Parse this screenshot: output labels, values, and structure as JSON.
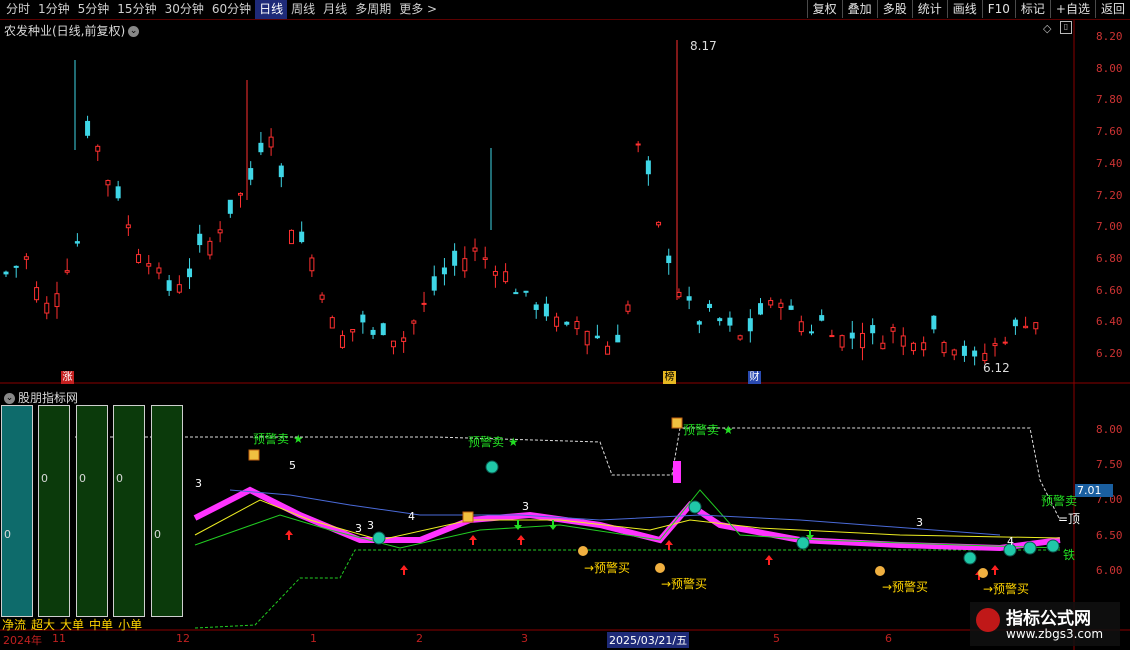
{
  "toolbar": {
    "periods": [
      "分时",
      "1分钟",
      "5分钟",
      "15分钟",
      "30分钟",
      "60分钟",
      "日线",
      "周线",
      "月线",
      "多周期",
      "更多 >"
    ],
    "active_period": "日线",
    "buttons": [
      "复权",
      "叠加",
      "多股",
      "统计",
      "画线",
      "F10",
      "标记",
      "+自选",
      "返回"
    ]
  },
  "stock": {
    "title": "农发种业(日线,前复权)",
    "high_label": "8.17",
    "low_label": "6.12",
    "marks": [
      "涨",
      "榜",
      "财"
    ],
    "price_axis": [
      "8.20",
      "8.00",
      "7.80",
      "7.60",
      "7.40",
      "7.20",
      "7.00",
      "6.80",
      "6.60",
      "6.40",
      "6.20"
    ]
  },
  "indicator": {
    "title": "股朋指标网",
    "axis": [
      "8.00",
      "7.50",
      "7.00",
      "6.50",
      "6.00"
    ],
    "current_value": "7.01",
    "signal_sell": "预警卖",
    "signal_buy": "→预警买",
    "side_text_1": "=顶",
    "side_text_2": "铁",
    "counts": [
      "3",
      "5",
      "3",
      "3",
      "4",
      "3",
      "3",
      "4"
    ]
  },
  "flow": {
    "labels": [
      "净流",
      "超大",
      "大单",
      "中单",
      "小单"
    ],
    "values": [
      "0",
      "0",
      "0",
      "0",
      "0"
    ],
    "colors": [
      "#0e6b6b",
      "#0b3a0b",
      "#0b3a0b",
      "#0b3a0b",
      "#0b3a0b"
    ]
  },
  "dates": {
    "labels": [
      "2024年",
      "11",
      "12",
      "1",
      "2",
      "3",
      "2025/03/21/五",
      "5",
      "6"
    ],
    "highlight": "2025/03/21/五"
  },
  "watermark": {
    "line1": "指标公式网",
    "line2": "www.zbgs3.com"
  },
  "colors": {
    "up": "#ff3030",
    "down": "#3fd6e6",
    "ma_pink": "#ff33ff",
    "sell": "#22dd22",
    "buy": "#ffd400"
  }
}
